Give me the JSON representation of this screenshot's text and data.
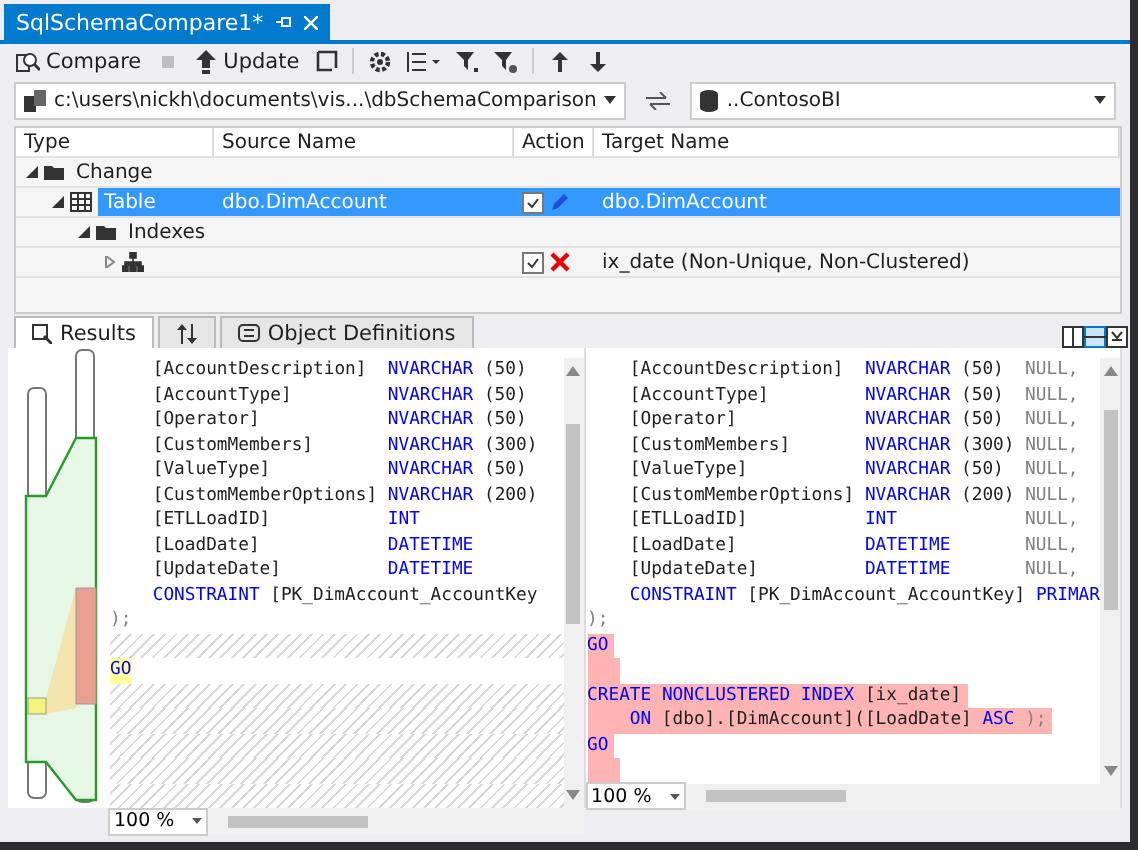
{
  "document_tab": {
    "title": "SqlSchemaCompare1*",
    "selected": true
  },
  "toolbar": [
    {
      "kind": "compare",
      "label": "Compare",
      "disabled": false
    },
    {
      "kind": "stop",
      "disabled": true
    },
    {
      "kind": "update",
      "label": "Update",
      "disabled": false
    },
    {
      "kind": "script",
      "disabled": false
    },
    {
      "kind": "options",
      "disabled": false
    },
    {
      "kind": "group",
      "disabled": false
    },
    {
      "kind": "filter",
      "disabled": false
    },
    {
      "kind": "filter-clear",
      "disabled": false
    },
    {
      "kind": "up",
      "disabled": false
    },
    {
      "kind": "down",
      "disabled": false
    }
  ],
  "source": {
    "value": "c:\\users\\nickh\\documents\\vis...\\dbSchemaComparison"
  },
  "target": {
    "value": "..ContosoBI"
  },
  "results_grid": {
    "columns": [
      "Type",
      "Source Name",
      "Action",
      "Target Name"
    ],
    "rows": [
      {
        "kind": "folder",
        "type": "Change",
        "expanded": true,
        "selected": false,
        "children": [
          {
            "kind": "table",
            "type": "Table",
            "source": "dbo.DimAccount",
            "checked": true,
            "action": {
              "kind": "change"
            },
            "target": "dbo.DimAccount",
            "expanded": true,
            "selected": true,
            "children": [
              {
                "kind": "folder",
                "type": "Indexes",
                "expanded": true,
                "selected": false,
                "children": [
                  {
                    "kind": "index",
                    "checked": true,
                    "action": {
                      "kind": "delete"
                    },
                    "target": "ix_date (Non-Unique, Non-Clustered)",
                    "expanded": false,
                    "selected": false
                  }
                ]
              }
            ]
          }
        ]
      }
    ]
  },
  "bottom_tabs": [
    {
      "kind": "results",
      "label": "Results",
      "selected": true
    },
    {
      "kind": "sort",
      "selected": false
    },
    {
      "kind": "definitions",
      "label": "Object Definitions",
      "selected": false
    }
  ],
  "code_panes": [
    {
      "zoom": "100 %",
      "lines": [
        {
          "kind": "column",
          "added": false,
          "matched": false,
          "name": "[AccountDescription]",
          "type": "NVARCHAR",
          "size": "(50)"
        },
        {
          "kind": "column",
          "added": false,
          "matched": false,
          "name": "[AccountType]",
          "type": "NVARCHAR",
          "size": "(50)"
        },
        {
          "kind": "column",
          "added": false,
          "matched": false,
          "name": "[Operator]",
          "type": "NVARCHAR",
          "size": "(50)"
        },
        {
          "kind": "column",
          "added": false,
          "matched": false,
          "name": "[CustomMembers]",
          "type": "NVARCHAR",
          "size": "(300)"
        },
        {
          "kind": "column",
          "added": false,
          "matched": false,
          "name": "[ValueType]",
          "type": "NVARCHAR",
          "size": "(50)"
        },
        {
          "kind": "column",
          "added": false,
          "matched": false,
          "name": "[CustomMemberOptions]",
          "type": "NVARCHAR",
          "size": "(200)"
        },
        {
          "kind": "column",
          "added": false,
          "matched": false,
          "name": "[ETLLoadID]",
          "type": "INT"
        },
        {
          "kind": "column",
          "added": false,
          "matched": false,
          "name": "[LoadDate]",
          "type": "DATETIME"
        },
        {
          "kind": "column",
          "added": false,
          "matched": false,
          "name": "[UpdateDate]",
          "type": "DATETIME"
        },
        {
          "kind": "text",
          "added": false,
          "matched": false,
          "indented": true,
          "segments": [
            {
              "text": "CONSTRAINT",
              "kind": "keyword"
            },
            {
              "text": "[PK_DimAccount_AccountKey",
              "kind": "plain"
            }
          ]
        },
        {
          "kind": "text",
          "added": false,
          "matched": false,
          "indented": false,
          "segments": [
            {
              "text": ");",
              "kind": "muted"
            }
          ]
        },
        {
          "kind": "gap"
        },
        {
          "kind": "text",
          "added": false,
          "matched": true,
          "indented": false,
          "segments": [
            {
              "text": "GO",
              "kind": "keyword"
            }
          ]
        },
        {
          "kind": "gap"
        },
        {
          "kind": "gap"
        },
        {
          "kind": "gap"
        },
        {
          "kind": "gap"
        },
        {
          "kind": "gap"
        }
      ]
    },
    {
      "zoom": "100 %",
      "lines": [
        {
          "kind": "column",
          "added": false,
          "matched": false,
          "name": "[AccountDescription]",
          "type": "NVARCHAR",
          "size": "(50)",
          "null": "NULL,"
        },
        {
          "kind": "column",
          "added": false,
          "matched": false,
          "name": "[AccountType]",
          "type": "NVARCHAR",
          "size": "(50)",
          "null": "NULL,"
        },
        {
          "kind": "column",
          "added": false,
          "matched": false,
          "name": "[Operator]",
          "type": "NVARCHAR",
          "size": "(50)",
          "null": "NULL,"
        },
        {
          "kind": "column",
          "added": false,
          "matched": false,
          "name": "[CustomMembers]",
          "type": "NVARCHAR",
          "size": "(300)",
          "null": "NULL,"
        },
        {
          "kind": "column",
          "added": false,
          "matched": false,
          "name": "[ValueType]",
          "type": "NVARCHAR",
          "size": "(50)",
          "null": "NULL,"
        },
        {
          "kind": "column",
          "added": false,
          "matched": false,
          "name": "[CustomMemberOptions]",
          "type": "NVARCHAR",
          "size": "(200)",
          "null": "NULL,"
        },
        {
          "kind": "column",
          "added": false,
          "matched": false,
          "name": "[ETLLoadID]",
          "type": "INT",
          "null": "NULL,"
        },
        {
          "kind": "column",
          "added": false,
          "matched": false,
          "name": "[LoadDate]",
          "type": "DATETIME",
          "null": "NULL,"
        },
        {
          "kind": "column",
          "added": false,
          "matched": false,
          "name": "[UpdateDate]",
          "type": "DATETIME",
          "null": "NULL,"
        },
        {
          "kind": "text",
          "added": false,
          "matched": false,
          "indented": true,
          "segments": [
            {
              "text": "CONSTRAINT",
              "kind": "keyword"
            },
            {
              "text": "[PK_DimAccount_AccountKey]",
              "kind": "plain"
            },
            {
              "text": "PRIMAR",
              "kind": "keyword"
            }
          ]
        },
        {
          "kind": "text",
          "added": false,
          "matched": false,
          "indented": false,
          "segments": [
            {
              "text": ");",
              "kind": "muted"
            }
          ]
        },
        {
          "kind": "text",
          "added": true,
          "matched": false,
          "indented": false,
          "segments": [
            {
              "text": "GO",
              "kind": "keyword"
            }
          ]
        },
        {
          "kind": "blank",
          "added": true
        },
        {
          "kind": "text",
          "added": true,
          "matched": false,
          "indented": false,
          "segments": [
            {
              "text": "CREATE NONCLUSTERED INDEX",
              "kind": "keyword"
            },
            {
              "text": "[ix_date]",
              "kind": "plain"
            }
          ]
        },
        {
          "kind": "text",
          "added": true,
          "matched": false,
          "indented": true,
          "segments": [
            {
              "text": "ON",
              "kind": "keyword"
            },
            {
              "text": "[dbo].[DimAccount]([LoadDate]",
              "kind": "plain"
            },
            {
              "text": "ASC",
              "kind": "keyword"
            },
            {
              "text": ");",
              "kind": "muted"
            }
          ]
        },
        {
          "kind": "text",
          "added": true,
          "matched": false,
          "indented": false,
          "segments": [
            {
              "text": "GO",
              "kind": "keyword"
            }
          ]
        },
        {
          "kind": "blank",
          "added": true
        }
      ]
    }
  ]
}
